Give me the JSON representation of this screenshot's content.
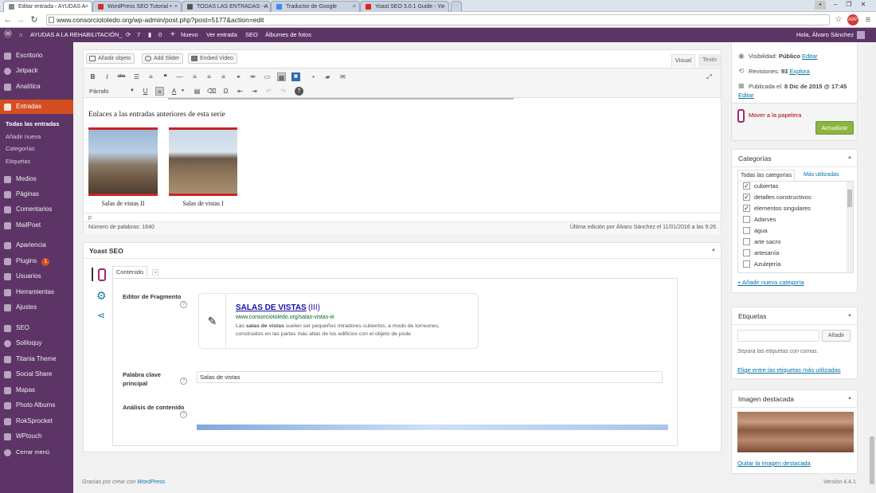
{
  "browser": {
    "tabs": [
      {
        "label": "Editar entrada ‹ AYUDAS A",
        "active": true,
        "fav_color": "#888888"
      },
      {
        "label": "WordPress SEO Tutorial • ",
        "active": false,
        "fav_color": "#d0312d"
      },
      {
        "label": "TODAS LAS ENTRADAS - A",
        "active": false,
        "fav_color": "#555555"
      },
      {
        "label": "Traductor de Google",
        "active": false,
        "fav_color": "#4285f4"
      },
      {
        "label": "Yoast SEO 3.0.1 Guide - Yo",
        "active": false,
        "fav_color": "#e62117"
      }
    ],
    "url": "www.consorciotoledo.org/wp-admin/post.php?post=5177&action=edit"
  },
  "adminbar": {
    "site": "AYUDAS A LA REHABILITACIÓN_",
    "updates": "7",
    "comments": "0",
    "new": "Nuevo",
    "view": "Ver entrada",
    "seo": "SEO",
    "albums": "Álbumes de fotos",
    "greeting": "Hola, Álvaro Sánchez"
  },
  "sidebar": {
    "items": [
      {
        "label": "Escritorio"
      },
      {
        "label": "Jetpack"
      },
      {
        "label": "Analítica"
      },
      {
        "label": "Entradas"
      },
      {
        "label": "Medios"
      },
      {
        "label": "Páginas"
      },
      {
        "label": "Comentarios"
      },
      {
        "label": "MailPoet"
      },
      {
        "label": "Apariencia"
      },
      {
        "label": "Plugins"
      },
      {
        "label": "Usuarios"
      },
      {
        "label": "Herramientas"
      },
      {
        "label": "Ajustes"
      },
      {
        "label": "SEO"
      },
      {
        "label": "Soliloquy"
      },
      {
        "label": "Titania Theme"
      },
      {
        "label": "Social Share"
      },
      {
        "label": "Mapas"
      },
      {
        "label": "Photo Albums"
      },
      {
        "label": "RokSprocket"
      },
      {
        "label": "WPtouch"
      },
      {
        "label": "Cerrar menú"
      }
    ],
    "plugins_badge": "1",
    "subitems": [
      "Todas las entradas",
      "Añadir nueva",
      "Categorías",
      "Etiquetas"
    ]
  },
  "editor": {
    "add_object": "Añadir objeto",
    "add_slider": "Add Slider",
    "embed_video": "Embed Video",
    "tab_visual": "Visual",
    "tab_text": "Texto",
    "format": "Párrafo",
    "content_heading": "Enlaces a las entradas anteriores de esta serie",
    "images": [
      {
        "caption": "Salas de vistas II"
      },
      {
        "caption": "Salas de vistas I"
      }
    ],
    "path": "p",
    "word_count": "Número de palabras: 1640",
    "last_edit": "Última edición por Álvaro Sánchez el 11/01/2016 a las 9:26"
  },
  "yoast": {
    "title": "Yoast SEO",
    "tab": "Contenido",
    "snippet_label": "Editor de Fragmento",
    "snippet_title": "SALAS DE VISTAS",
    "snippet_title_suffix": "(III)",
    "snippet_url": "www.consorciotoledo.org/salas-vistas-iii",
    "snippet_desc_pre": "Las ",
    "snippet_desc_bold": "salas de vistas",
    "snippet_desc_post": " suelen ser pequeños miradores cubiertos, a modo de torreones, construidos en las partes más altas de los edificios con el objeto de pode",
    "keyword_label": "Palabra clave principal",
    "keyword_value": "Salas de vistas",
    "analysis_label": "Análisis de contenido"
  },
  "publish": {
    "visibility_label": "Visibilidad:",
    "visibility_value": "Público",
    "visibility_edit": "Editar",
    "revisions_label": "Revisiones:",
    "revisions_value": "93",
    "revisions_link": "Explora",
    "published_label": "Publicada el:",
    "published_value": "8 Dic de 2015 @ 17:45",
    "published_edit": "Editar",
    "trash": "Mover a la papelera",
    "update": "Actualizar"
  },
  "categories": {
    "title": "Categorías",
    "tab_all": "Todas las categorías",
    "tab_used": "Más utilizadas",
    "items": [
      {
        "label": "cubiertas",
        "checked": "✓"
      },
      {
        "label": "detalles constructivos",
        "checked": "✓"
      },
      {
        "label": "elementos singulares",
        "checked": "✓"
      },
      {
        "label": "Adarves",
        "checked": ""
      },
      {
        "label": "agua",
        "checked": ""
      },
      {
        "label": "arte sacro",
        "checked": ""
      },
      {
        "label": "artesanía",
        "checked": ""
      },
      {
        "label": "Azulejería",
        "checked": ""
      }
    ],
    "add_new": "+ Añadir nueva categoría"
  },
  "tags": {
    "title": "Etiquetas",
    "add": "Añadir",
    "hint": "Separa las etiquetas con comas.",
    "choose": "Elige entre las etiquetas más utilizadas"
  },
  "featured": {
    "title": "Imagen destacada",
    "remove": "Quitar la imagen destacada"
  },
  "footer": {
    "thanks_pre": "Gracias por crear con ",
    "thanks_link": "WordPress",
    "thanks_post": ".",
    "version": "Versión 4.4.1"
  },
  "colors": {
    "admin_purple": "#5c3566",
    "active_menu": "#d54e21",
    "link": "#0073aa",
    "snippet_title": "#1a0dab",
    "snippet_url": "#006621",
    "update_button": "#8ab63f",
    "yoast_red": "#a4286a"
  }
}
